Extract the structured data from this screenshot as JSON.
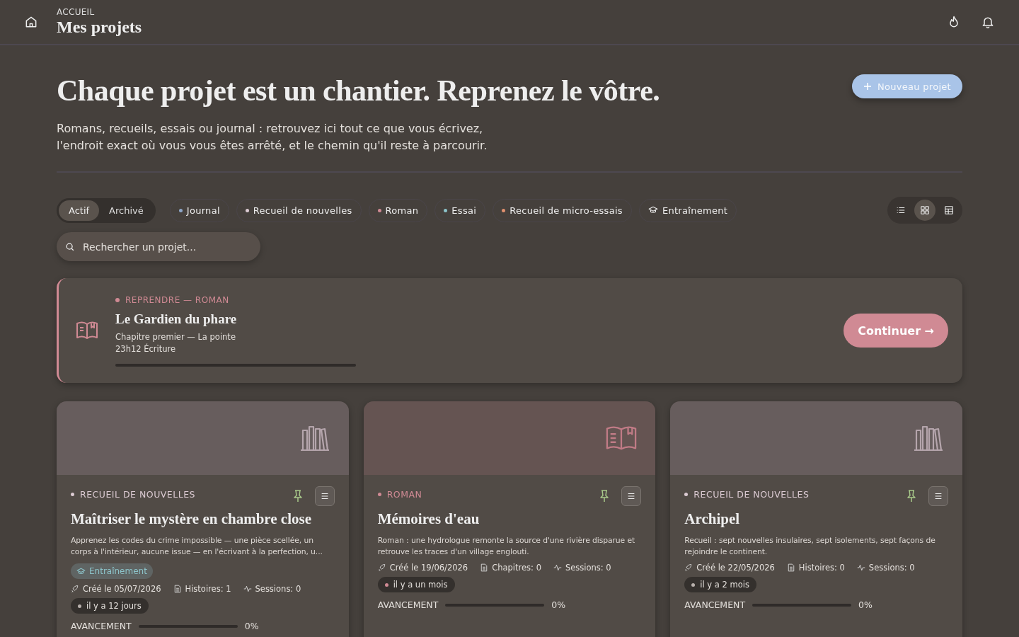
{
  "header": {
    "breadcrumb": "ACCUEIL",
    "title": "Mes projets"
  },
  "hero": {
    "title": "Chaque projet est un chantier. Reprenez le vôtre.",
    "subtitle_lines": [
      "Romans, recueils, essais ou journal : retrouvez ici tout ce que vous écrivez,",
      "l'endroit exact où vous vous êtes arrêté, et le chemin qu'il reste à parcourir."
    ],
    "new_button": "Nouveau projet"
  },
  "status_tabs": [
    {
      "label": "Actif",
      "selected": true
    },
    {
      "label": "Archivé",
      "selected": false
    }
  ],
  "filters": [
    {
      "label": "Journal",
      "kind": "dot",
      "color": "#8fa7c9"
    },
    {
      "label": "Recueil de nouvelles",
      "kind": "dot",
      "color": "#dccbd3"
    },
    {
      "label": "Roman",
      "kind": "dot",
      "color": "#d08a94"
    },
    {
      "label": "Essai",
      "kind": "dot",
      "color": "#8cc3c9"
    },
    {
      "label": "Recueil de micro-essais",
      "kind": "dot",
      "color": "#e0906e"
    },
    {
      "label": "Entraînement",
      "kind": "icon"
    }
  ],
  "views": [
    {
      "kind": "list",
      "selected": false
    },
    {
      "kind": "grid",
      "selected": true
    },
    {
      "kind": "table",
      "selected": false
    }
  ],
  "search": {
    "placeholder": "Rechercher un projet..."
  },
  "resume": {
    "label": "REPRENDRE — ROMAN",
    "title": "Le Gardien du phare",
    "chapter": "Chapitre premier — La pointe",
    "time": "23h12 Écriture",
    "level": 0,
    "button": "Continuer →"
  },
  "projects": [
    {
      "cover": {
        "kind": "shelf",
        "color": "#675d5d"
      },
      "category": {
        "label": "RECUEIL DE NOUVELLES",
        "color": "#dccbd3"
      },
      "pinned": true,
      "title": "Maîtriser le mystère en chambre close",
      "description": "Apprenez les codes du crime impossible — une pièce scellée, un corps à l'intérieur, aucune issue — en l'écrivant à la perfection, u...",
      "tag": "Entraînement",
      "created": "Créé le 05/07/2026",
      "count": "Histoires: 1",
      "sessions": "Sessions: 0",
      "ago": {
        "label": "il y a 12 jours",
        "color": "#b8b0ac"
      },
      "progress_label": "AVANCEMENT",
      "level": 0,
      "percent": "0%"
    },
    {
      "cover": {
        "kind": "book",
        "color": "#655452"
      },
      "category": {
        "label": "ROMAN",
        "color": "#d08a94"
      },
      "pinned": true,
      "title": "Mémoires d'eau",
      "description": "Roman : une hydrologue remonte la source d'une rivière disparue et retrouve les traces d'un village englouti.",
      "created": "Créé le 19/06/2026",
      "count": "Chapitres: 0",
      "sessions": "Sessions: 0",
      "ago": {
        "label": "il y a un mois",
        "color": "#d08a94"
      },
      "progress_label": "AVANCEMENT",
      "level": 0,
      "percent": "0%"
    },
    {
      "cover": {
        "kind": "shelf",
        "color": "#675d5d"
      },
      "category": {
        "label": "RECUEIL DE NOUVELLES",
        "color": "#dccbd3"
      },
      "pinned": true,
      "title": "Archipel",
      "description": "Recueil : sept nouvelles insulaires, sept isolements, sept façons de rejoindre le continent.",
      "created": "Créé le 22/05/2026",
      "count": "Histoires: 0",
      "sessions": "Sessions: 0",
      "ago": {
        "label": "il y a 2 mois",
        "color": "#b8b0ac"
      },
      "progress_label": "AVANCEMENT",
      "level": 0,
      "percent": "0%"
    }
  ]
}
